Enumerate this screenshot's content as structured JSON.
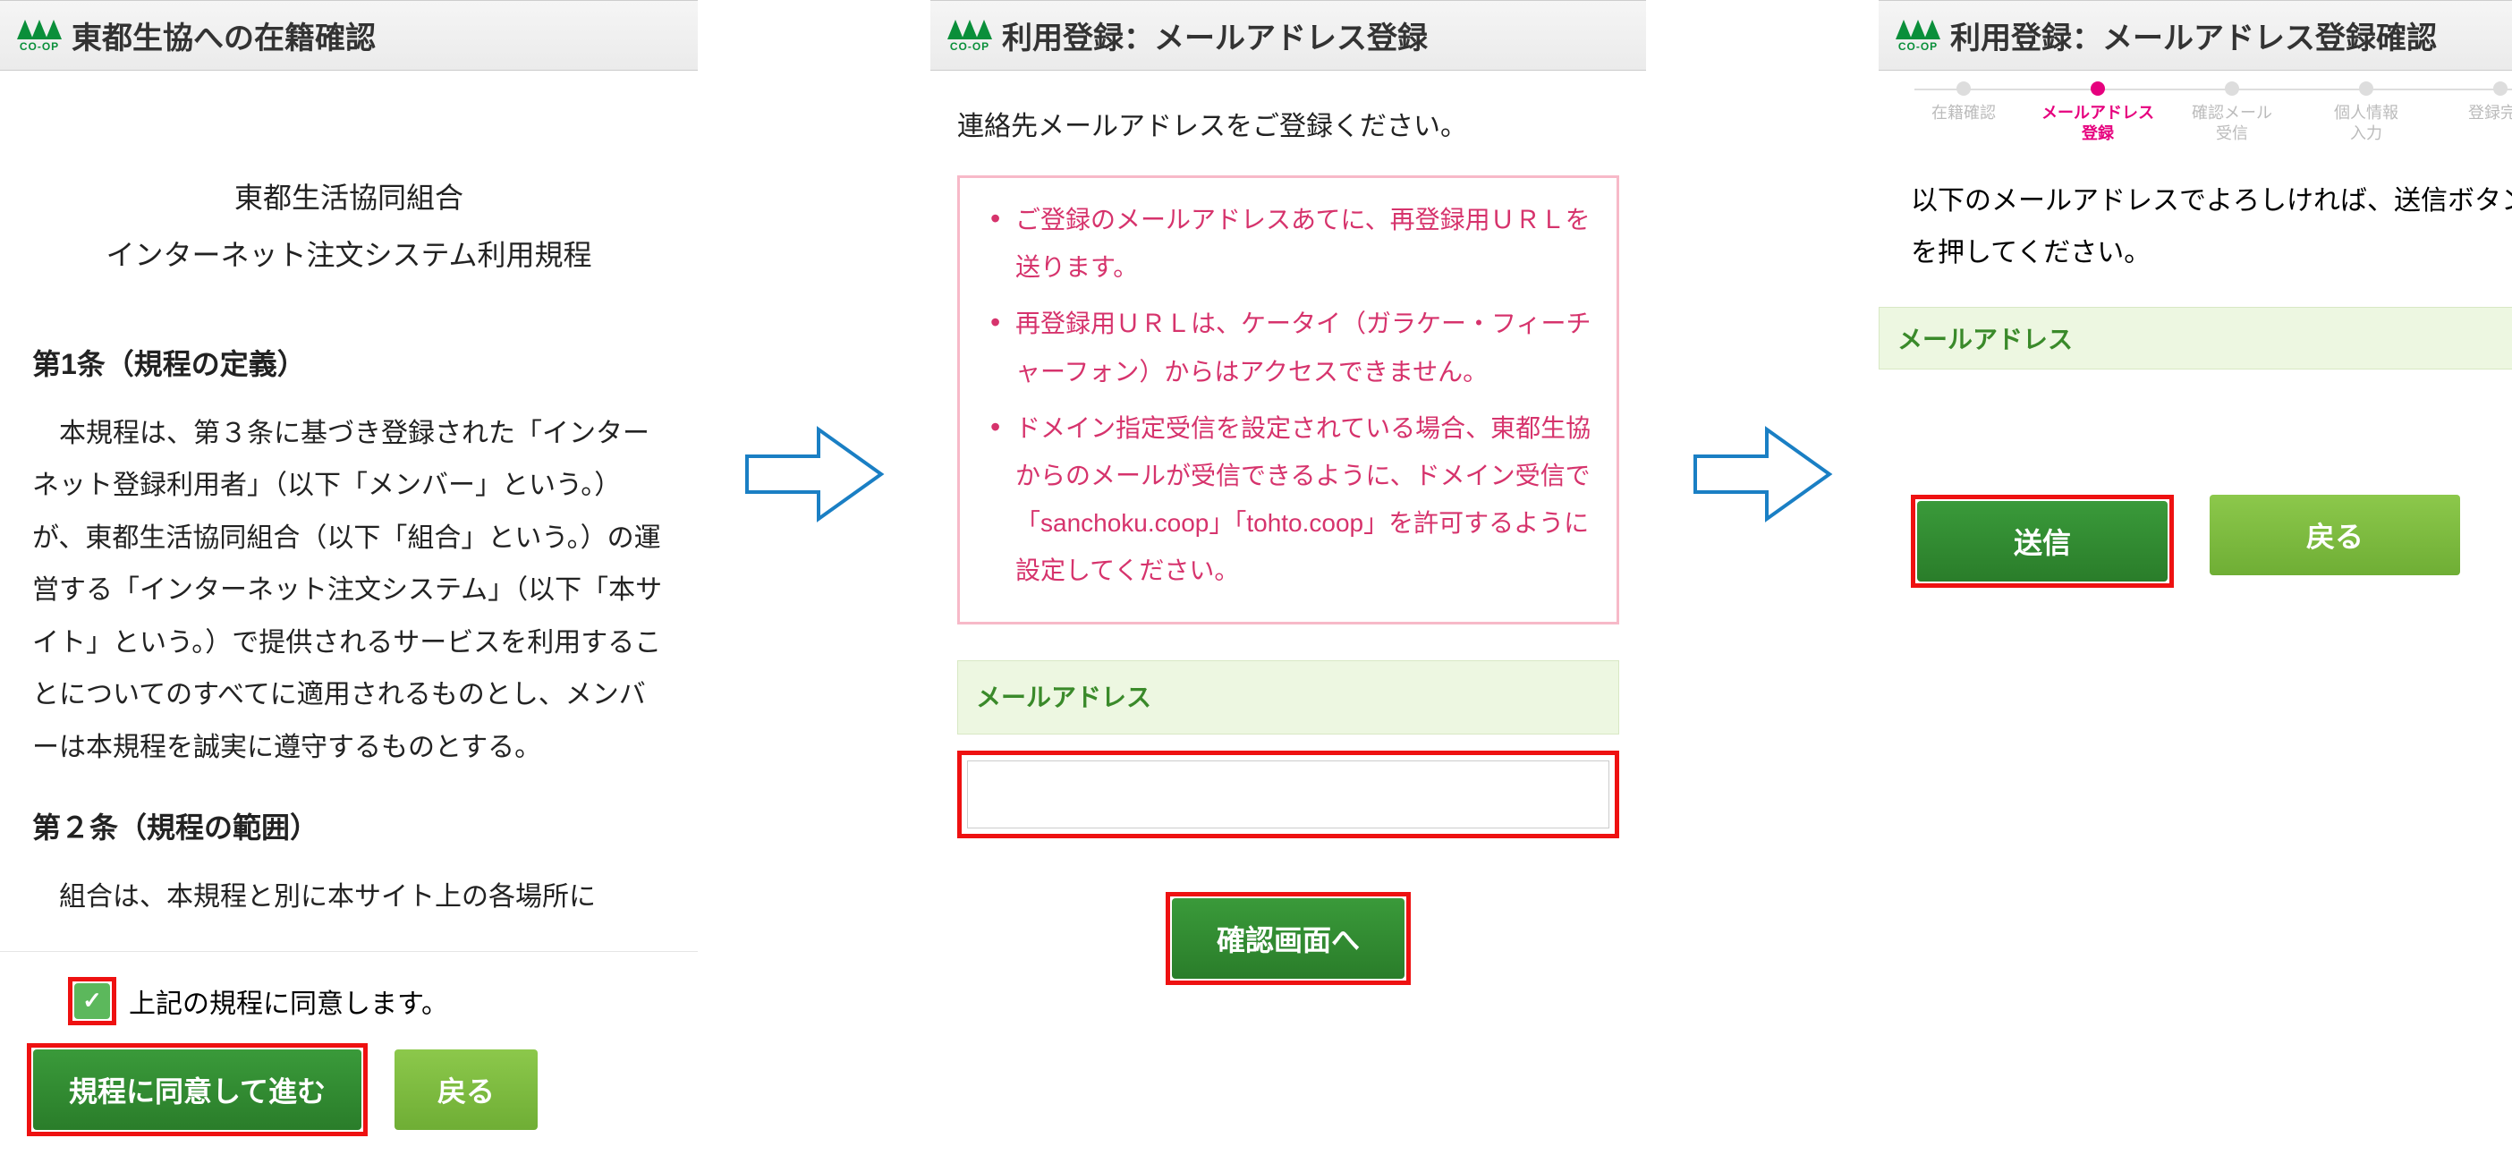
{
  "panel1": {
    "header_title": "東都生協への在籍確認",
    "intro_line1": "東都生活協同組合",
    "intro_line2": "インターネット注文システム利用規程",
    "article1_heading": "第1条（規程の定義）",
    "article1_body": "本規程は、第３条に基づき登録された「インターネット登録利用者」（以下「メンバー」という。）が、東都生活協同組合（以下「組合」という。）の運営する「インターネット注文システム」（以下「本サイト」という。）で提供されるサービスを利用することについてのすべてに適用されるものとし、メンバーは本規程を誠実に遵守するものとする。",
    "article2_heading": "第２条（規程の範囲）",
    "article2_body": "組合は、本規程と別に本サイト上の各場所に",
    "agree_label": "上記の規程に同意します。",
    "btn_agree": "規程に同意して進む",
    "btn_back": "戻る",
    "logo_text": "CO-OP"
  },
  "panel2": {
    "header_title": "利用登録：メールアドレス登録",
    "subtext": "連絡先メールアドレスをご登録ください。",
    "note1": "ご登録のメールアドレスあてに、再登録用ＵＲＬを送ります。",
    "note2": "再登録用ＵＲＬは、ケータイ（ガラケー・フィーチャーフォン）からはアクセスできません。",
    "note3": "ドメイン指定受信を設定されている場合、東都生協からのメールが受信できるように、ドメイン受信で「sanchoku.coop」「tohto.coop」を許可するように設定してください。",
    "field_label": "メールアドレス",
    "input_value": "",
    "btn_confirm": "確認画面へ",
    "logo_text": "CO-OP"
  },
  "panel3": {
    "header_title": "利用登録：メールアドレス登録確認",
    "steps": [
      "在籍確認",
      "メールアドレス\n登録",
      "確認メール\n受信",
      "個人情報\n入力",
      "登録完了"
    ],
    "active_step_index": 1,
    "confirm_text": "以下のメールアドレスでよろしければ、送信ボタンを押してください。",
    "field_label": "メールアドレス",
    "email_value": "",
    "btn_send": "送信",
    "btn_back": "戻る",
    "logo_text": "CO-OP"
  }
}
